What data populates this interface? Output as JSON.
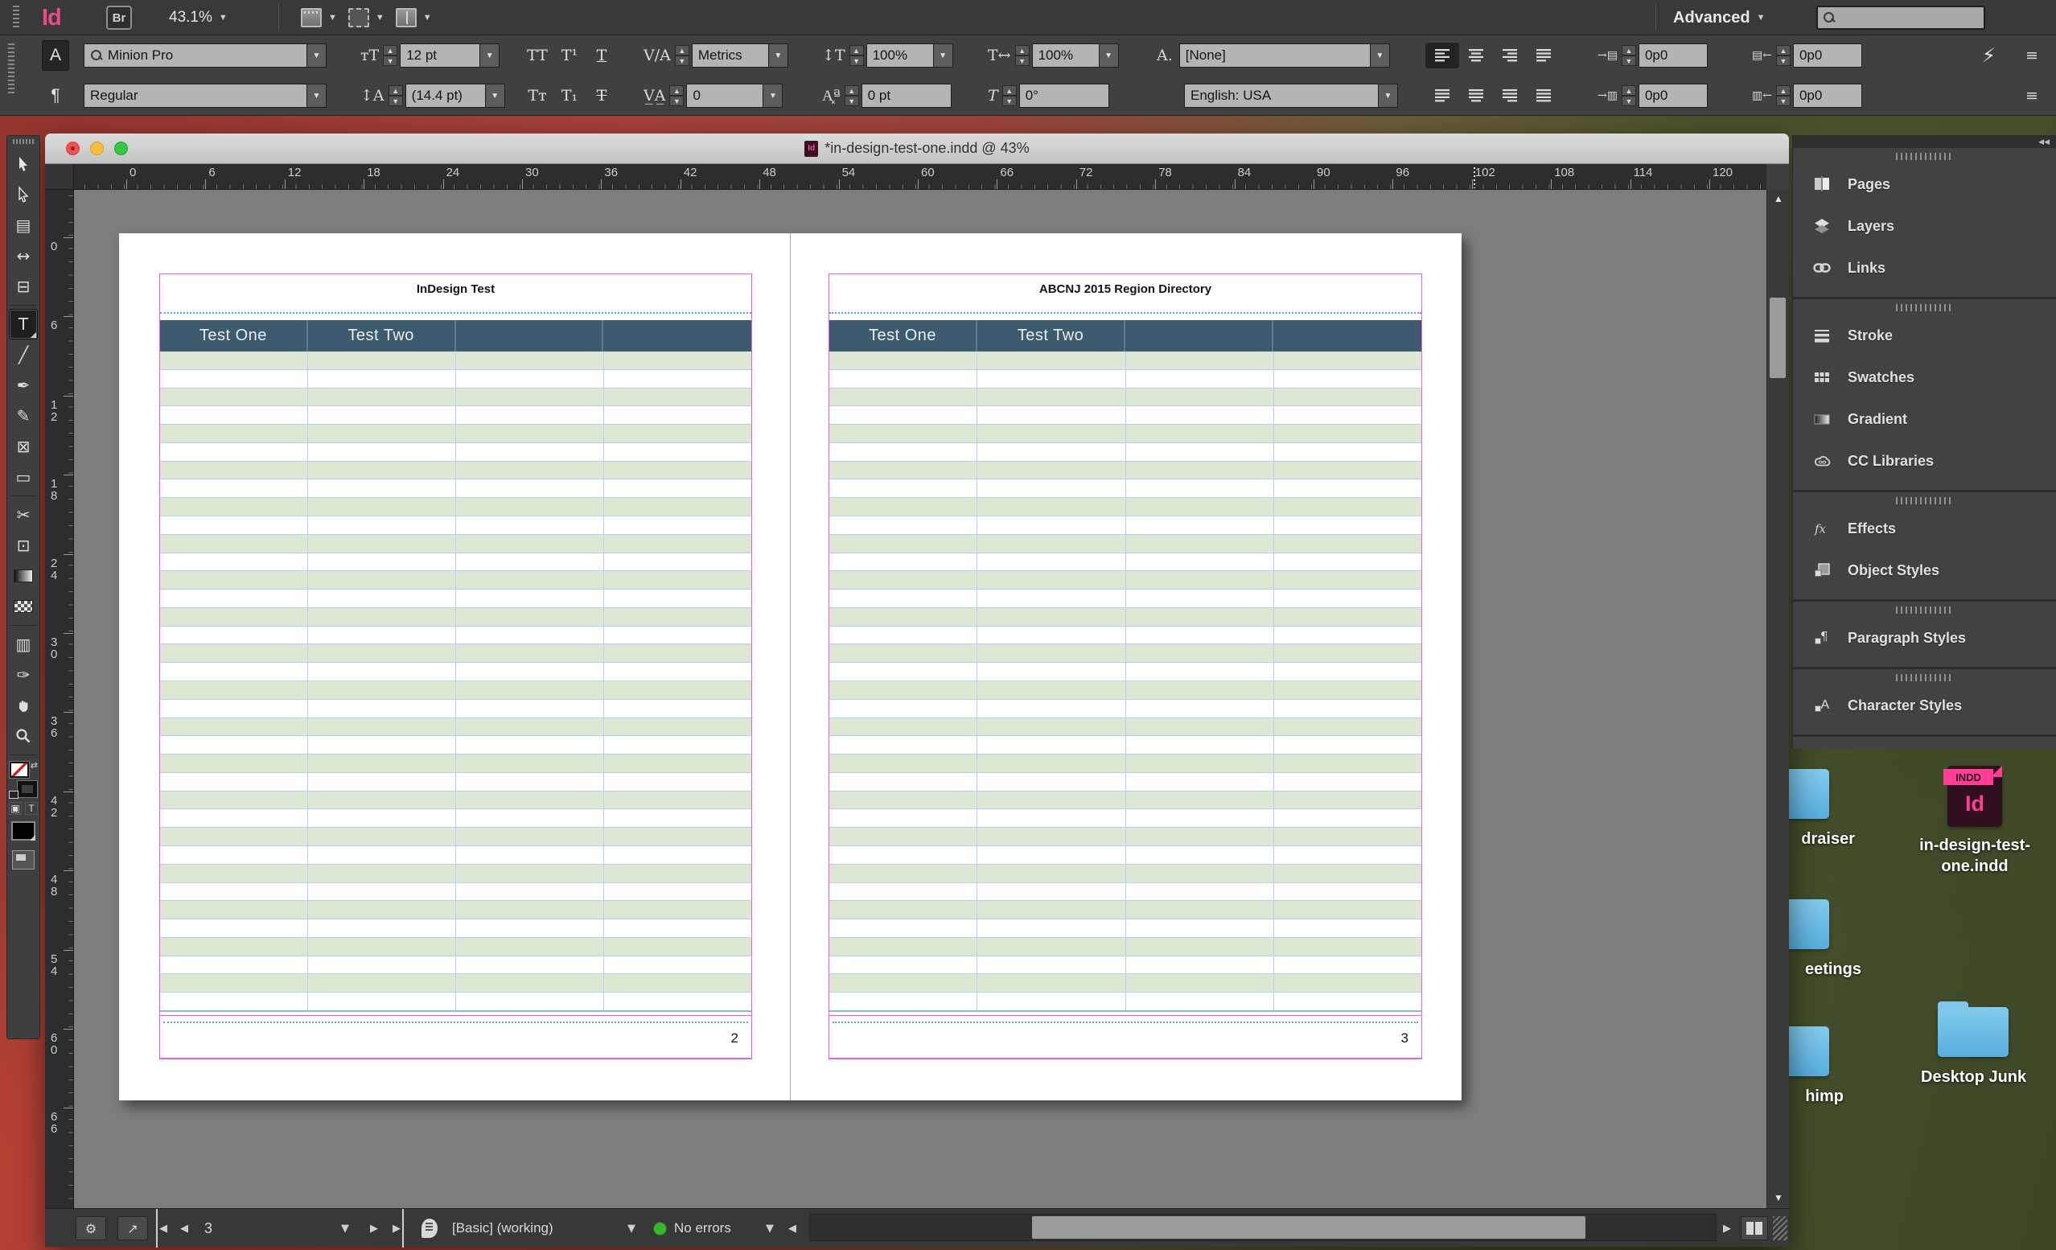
{
  "top_bar": {
    "logo": "Id",
    "bridge_label": "Br",
    "zoom_level": "43.1%",
    "workspace_label": "Advanced",
    "view_buttons": [
      "screen-mode-view",
      "frame-edges-view",
      "window-layout-view"
    ]
  },
  "control_panel": {
    "char_mode_label": "A",
    "para_mode_label": "¶",
    "font_family": "Minion Pro",
    "font_style": "Regular",
    "font_size": "12 pt",
    "leading": "(14.4 pt)",
    "kerning": "Metrics",
    "tracking": "0",
    "vertical_scale": "100%",
    "horizontal_scale": "100%",
    "baseline_shift": "0 pt",
    "skew": "0°",
    "character_style": "[None]",
    "language": "English: USA",
    "left_indent": "0p0",
    "right_indent": "0p0",
    "first_line_indent": "0p0",
    "last_line_indent": "0p0",
    "case_buttons_row1": [
      "TT",
      "T¹",
      "T"
    ],
    "case_buttons_row2": [
      "Tᴛ",
      "T₁",
      "T"
    ],
    "char_style_icon_label": "A.",
    "lightning_icon": "⚡",
    "panel_menu_icon": "≡"
  },
  "tools": [
    {
      "name": "selection-tool",
      "glyph": "svg-arrow-filled"
    },
    {
      "name": "direct-selection-tool",
      "glyph": "svg-arrow-outline"
    },
    {
      "name": "page-tool",
      "glyph": "▤"
    },
    {
      "name": "gap-tool",
      "glyph": "↔"
    },
    {
      "name": "content-collector-tool",
      "glyph": "⊟",
      "divider_after": true
    },
    {
      "name": "type-tool",
      "glyph": "T",
      "selected": true
    },
    {
      "name": "line-tool",
      "glyph": "╱"
    },
    {
      "name": "pen-tool",
      "glyph": "✒"
    },
    {
      "name": "pencil-tool",
      "glyph": "✎"
    },
    {
      "name": "frame-tool",
      "glyph": "⊠"
    },
    {
      "name": "rectangle-tool",
      "glyph": "▭",
      "divider_after": true
    },
    {
      "name": "scissors-tool",
      "glyph": "✂"
    },
    {
      "name": "free-transform-tool",
      "glyph": "⊡"
    },
    {
      "name": "gradient-tool",
      "glyph": "chip-gradient"
    },
    {
      "name": "gradient-feather-tool",
      "glyph": "chip-checker",
      "divider_after": true
    },
    {
      "name": "note-tool",
      "glyph": "▥"
    },
    {
      "name": "eyedropper-tool",
      "glyph": "✑"
    },
    {
      "name": "hand-tool",
      "glyph": "svg-hand"
    },
    {
      "name": "zoom-tool",
      "glyph": "svg-magnifier"
    }
  ],
  "document_window": {
    "title": "*in-design-test-one.indd @ 43%",
    "h_ruler_labels": [
      "0",
      "6",
      "12",
      "18",
      "24",
      "30",
      "36",
      "42",
      "48",
      "54",
      "60",
      "66",
      "72",
      "78",
      "84",
      "90",
      "96",
      "102",
      "108",
      "114",
      "120"
    ],
    "v_ruler_labels": [
      "0",
      "6",
      "12",
      "18",
      "24",
      "30",
      "36",
      "42",
      "48",
      "54",
      "60",
      "66"
    ]
  },
  "pages": [
    {
      "title": "InDesign Test",
      "page_number": "2",
      "table": {
        "headers": [
          "Test One",
          "Test Two",
          "",
          ""
        ],
        "body_rows": 36,
        "columns": 4
      }
    },
    {
      "title": "ABCNJ 2015 Region Directory",
      "page_number": "3",
      "table": {
        "headers": [
          "Test One",
          "Test Two",
          "",
          ""
        ],
        "body_rows": 36,
        "columns": 4
      }
    }
  ],
  "status_bar": {
    "version_sync_icon": "⚙",
    "share_icon": "↗",
    "current_page": "3",
    "preflight_profile": "[Basic] (working)",
    "preflight_status": "No errors"
  },
  "panel_dock": {
    "collapse_icon": "◀◀",
    "groups": [
      {
        "items": [
          {
            "label": "Pages",
            "icon": "pages-icon"
          },
          {
            "label": "Layers",
            "icon": "layers-icon"
          },
          {
            "label": "Links",
            "icon": "links-icon"
          }
        ]
      },
      {
        "items": [
          {
            "label": "Stroke",
            "icon": "stroke-icon"
          },
          {
            "label": "Swatches",
            "icon": "swatches-icon"
          },
          {
            "label": "Gradient",
            "icon": "gradient-icon"
          },
          {
            "label": "CC Libraries",
            "icon": "cc-libraries-icon"
          }
        ]
      },
      {
        "items": [
          {
            "label": "Effects",
            "icon": "effects-icon"
          },
          {
            "label": "Object Styles",
            "icon": "object-styles-icon"
          }
        ]
      },
      {
        "items": [
          {
            "label": "Paragraph Styles",
            "icon": "paragraph-styles-icon"
          }
        ]
      },
      {
        "items": [
          {
            "label": "Character Styles",
            "icon": "character-styles-icon"
          }
        ]
      }
    ]
  },
  "desktop": {
    "folder_label_1": "draiser",
    "folder_label_2": "eetings",
    "folder_label_3": "himp",
    "indd_file_label": "in-design-test-one.indd",
    "indd_badge": "INDD",
    "indd_logo": "Id",
    "junk_folder_label": "Desktop Junk"
  },
  "colors": {
    "accent_pink": "#e84a8a",
    "frame_pink": "#ea5ae2",
    "guide_blue": "#5aa2dd",
    "table_header_blue": "#3d5a6f",
    "row_green": "#dde8d4",
    "grid_blue": "#b6d0ea",
    "no_errors_green": "#3cb52e",
    "folder_blue": "#66bbe8"
  }
}
